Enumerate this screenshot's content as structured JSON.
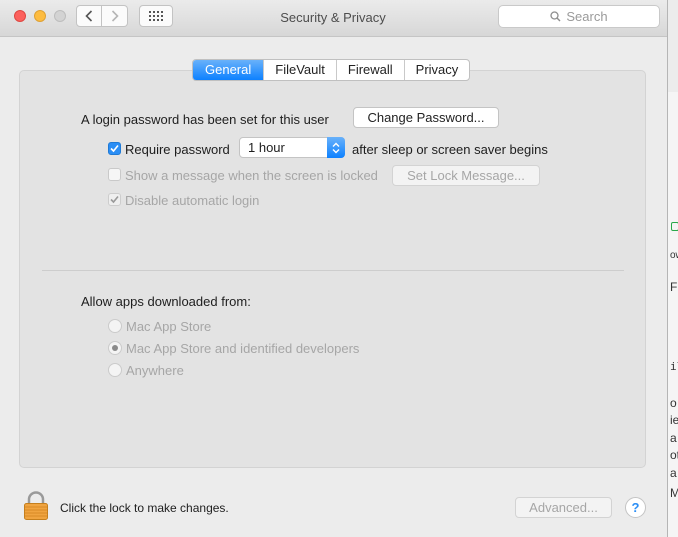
{
  "window": {
    "title": "Security & Privacy",
    "search_placeholder": "Search"
  },
  "tabs": [
    {
      "label": "General",
      "active": true
    },
    {
      "label": "FileVault",
      "active": false
    },
    {
      "label": "Firewall",
      "active": false
    },
    {
      "label": "Privacy",
      "active": false
    }
  ],
  "general": {
    "login_password_text": "A login password has been set for this user",
    "change_password_button": "Change Password...",
    "require_password": {
      "label": "Require password",
      "checked": true
    },
    "require_password_delay": "1 hour",
    "after_sleep_text": "after sleep or screen saver begins",
    "show_message": {
      "label": "Show a message when the screen is locked",
      "checked": false
    },
    "set_lock_message_button": "Set Lock Message...",
    "disable_auto_login": {
      "label": "Disable automatic login",
      "checked": true
    }
  },
  "allow_apps": {
    "heading": "Allow apps downloaded from:",
    "options": [
      {
        "label": "Mac App Store",
        "selected": false
      },
      {
        "label": "Mac App Store and identified developers",
        "selected": true
      },
      {
        "label": "Anywhere",
        "selected": false
      }
    ]
  },
  "footer": {
    "lock_text": "Click the lock to make changes.",
    "advanced_button": "Advanced...",
    "help_button": "?"
  },
  "background_window": {
    "fragments": [
      "ow",
      "F",
      "ile",
      "o",
      "ie",
      "a",
      "ot",
      "a",
      "M"
    ]
  },
  "colors": {
    "accent": "#0d81ff",
    "lock": "#f0a440"
  }
}
